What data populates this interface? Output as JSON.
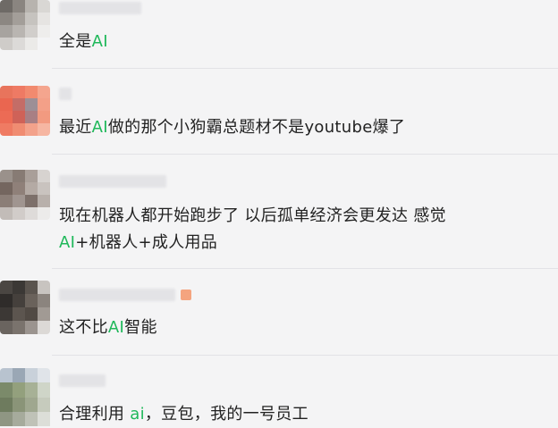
{
  "accent_color": "#1fb85a",
  "comments": [
    {
      "before": "全是",
      "ai": "AI",
      "after": ""
    },
    {
      "before": "最近",
      "ai": "AI",
      "after": "做的那个小狗霸总题材不是youtube爆了"
    },
    {
      "line1": "现在机器人都开始跑步了 以后孤单经济会更发达 感觉",
      "ai": "AI",
      "after": "+机器人+成人用品"
    },
    {
      "before": "这不比",
      "ai": "AI",
      "after": "智能"
    },
    {
      "before": "合理利用 ",
      "ai": "ai",
      "after": "，豆包，我的一号员工"
    }
  ]
}
